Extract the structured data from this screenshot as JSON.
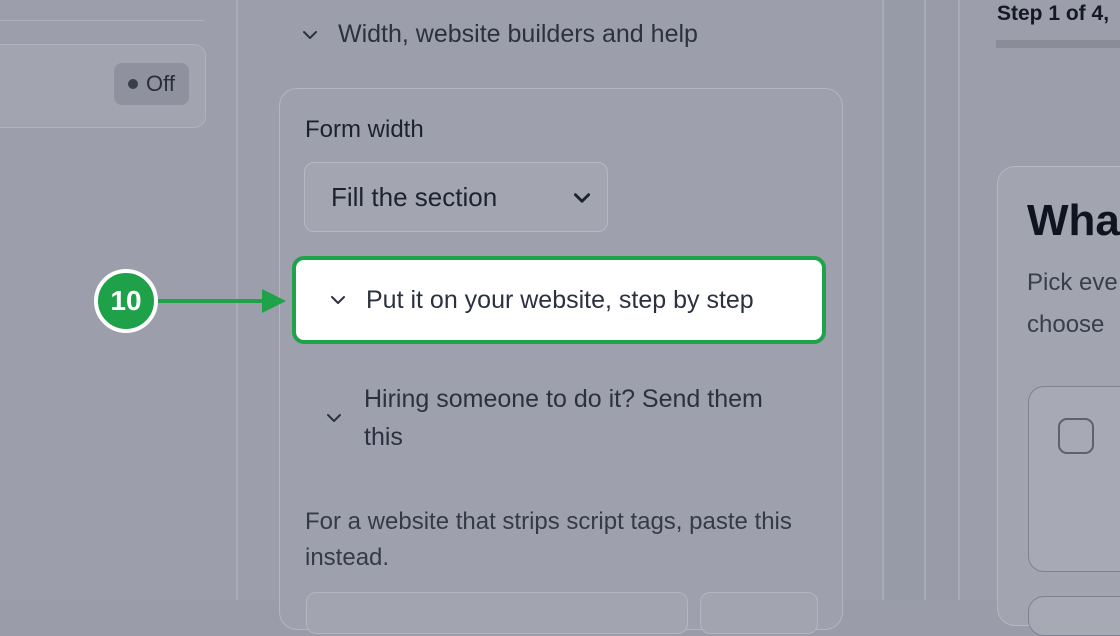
{
  "left_panel": {
    "status_toggle": {
      "label": "Off"
    }
  },
  "middle_panel": {
    "section_header": "Width, website builders and help",
    "form_width": {
      "label": "Form width",
      "selected_option": "Fill the section"
    },
    "put_on_website": {
      "label": "Put it on your website, step by step"
    },
    "hiring": {
      "label": "Hiring someone to do it? Send them this"
    },
    "strip_note": "For a website that strips script tags, paste this instead."
  },
  "annotation": {
    "step_number": "10",
    "color": "#20a24a"
  },
  "right_panel": {
    "step_indicator": "Step 1 of 4,",
    "preview_title": "Wha",
    "preview_subtitle_line1": "Pick eve",
    "preview_subtitle_line2": "choose"
  },
  "icons": {
    "chevron": "chevron-down-icon",
    "status_dot": "dot-icon"
  }
}
